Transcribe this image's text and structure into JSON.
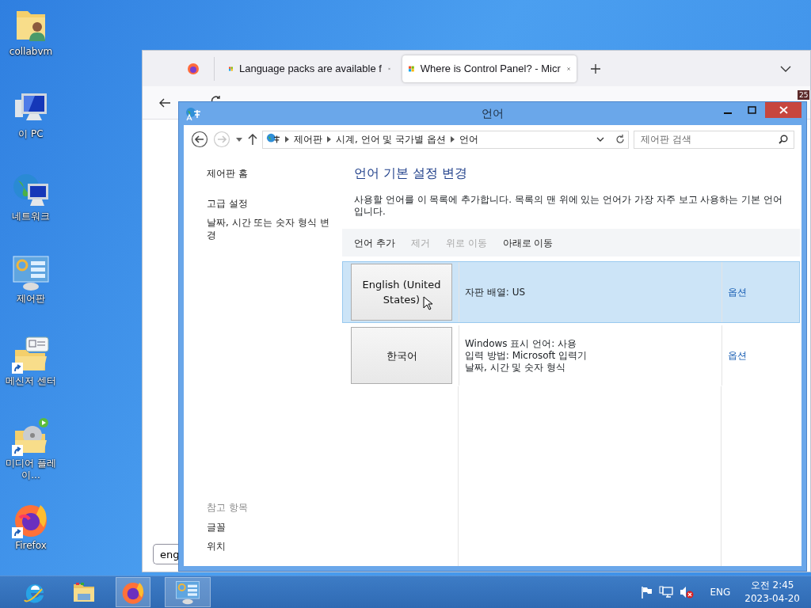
{
  "desktop_icons": [
    {
      "label": "collabvm",
      "kind": "user-folder",
      "shortcut": false
    },
    {
      "label": "이 PC",
      "kind": "computer",
      "shortcut": false
    },
    {
      "label": "네트워크",
      "kind": "network",
      "shortcut": false
    },
    {
      "label": "제어판",
      "kind": "control-panel",
      "shortcut": false
    },
    {
      "label": "메신저 센터",
      "kind": "messenger-folder",
      "shortcut": true
    },
    {
      "label": "미디어 플레이...",
      "kind": "media-folder",
      "shortcut": true
    },
    {
      "label": "Firefox",
      "kind": "firefox",
      "shortcut": true
    }
  ],
  "browser": {
    "tabs": [
      {
        "label": "Language packs are available f",
        "selected": false
      },
      {
        "label": "Where is Control Panel? - Micr",
        "selected": true
      }
    ],
    "extension_badge": "25",
    "search_field": {
      "value": "eng"
    }
  },
  "control_panel": {
    "title": "언어",
    "forward_enabled": false,
    "breadcrumb": [
      "제어판",
      "시계, 언어 및 국가별 옵션",
      "언어"
    ],
    "search": {
      "placeholder": "제어판 검색"
    },
    "nav_links": [
      "제어판 홈",
      "고급 설정",
      "날짜, 시간 또는 숫자 형식 변경"
    ],
    "see_also": {
      "heading": "참고 항목",
      "links": [
        "글꼴",
        "위치"
      ]
    },
    "heading": "언어 기본 설정 변경",
    "description": "사용할 언어를 이 목록에 추가합니다. 목록의 맨 위에 있는 언어가 가장 자주 보고 사용하는 기본 언어입니다.",
    "toolbar": [
      {
        "label": "언어 추가",
        "disabled": false
      },
      {
        "label": "제거",
        "disabled": true
      },
      {
        "label": "위로 이동",
        "disabled": true
      },
      {
        "label": "아래로 이동",
        "disabled": false
      }
    ],
    "languages": [
      {
        "name": "English (United States)",
        "details": [
          "자판 배열: US"
        ],
        "options": "옵션",
        "selected": true
      },
      {
        "name": "한국어",
        "details": [
          "Windows 표시 언어: 사용",
          "입력 방법: Microsoft 입력기",
          "날짜, 시간 및 숫자 형식"
        ],
        "options": "옵션",
        "selected": false
      }
    ]
  },
  "taskbar": {
    "apps": [
      {
        "kind": "ie",
        "active": false
      },
      {
        "kind": "explorer",
        "active": false
      },
      {
        "kind": "firefox",
        "active": true
      },
      {
        "kind": "control-panel",
        "active": true
      }
    ],
    "sound_muted": true,
    "language": "ENG",
    "time": "오전 2:45",
    "date": "2023-04-20"
  }
}
